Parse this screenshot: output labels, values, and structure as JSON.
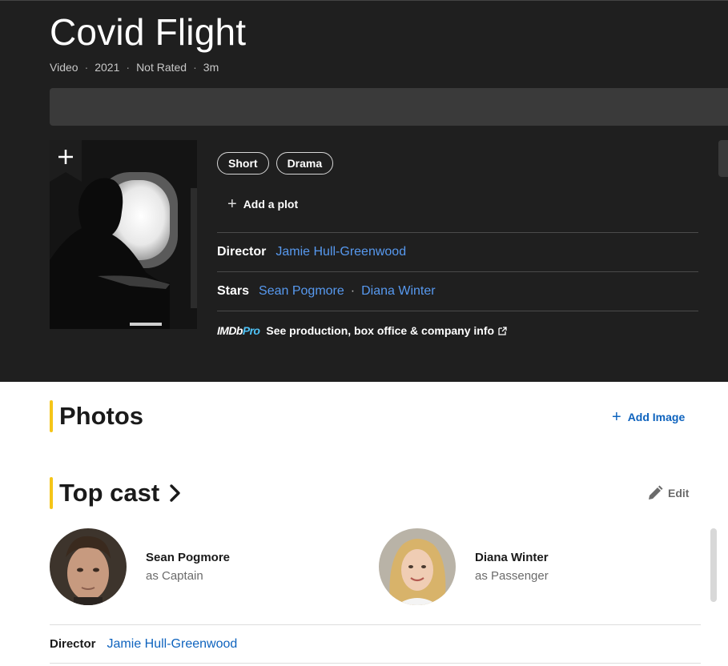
{
  "hero": {
    "title": "Covid Flight",
    "meta": [
      "Video",
      "2021",
      "Not Rated",
      "3m"
    ],
    "genres": [
      "Short",
      "Drama"
    ],
    "add_plot": "Add a plot",
    "director_label": "Director",
    "director": "Jamie Hull-Greenwood",
    "stars_label": "Stars",
    "stars": [
      "Sean Pogmore",
      "Diana Winter"
    ],
    "imdbpro_logo_imdb": "IMDb",
    "imdbpro_logo_pro": "Pro",
    "imdbpro_text": "See production, box office & company info"
  },
  "photos": {
    "title": "Photos",
    "add_image": "Add Image"
  },
  "top_cast": {
    "title": "Top cast",
    "edit": "Edit",
    "cast": [
      {
        "name": "Sean Pogmore",
        "role": "as Captain"
      },
      {
        "name": "Diana Winter",
        "role": "as Passenger"
      }
    ],
    "director_label": "Director",
    "director": "Jamie Hull-Greenwood"
  },
  "colors": {
    "hero_bg": "#1f1f1f",
    "accent": "#f5c518",
    "link_dark": "#5799ef",
    "link_light": "#0e63be"
  }
}
